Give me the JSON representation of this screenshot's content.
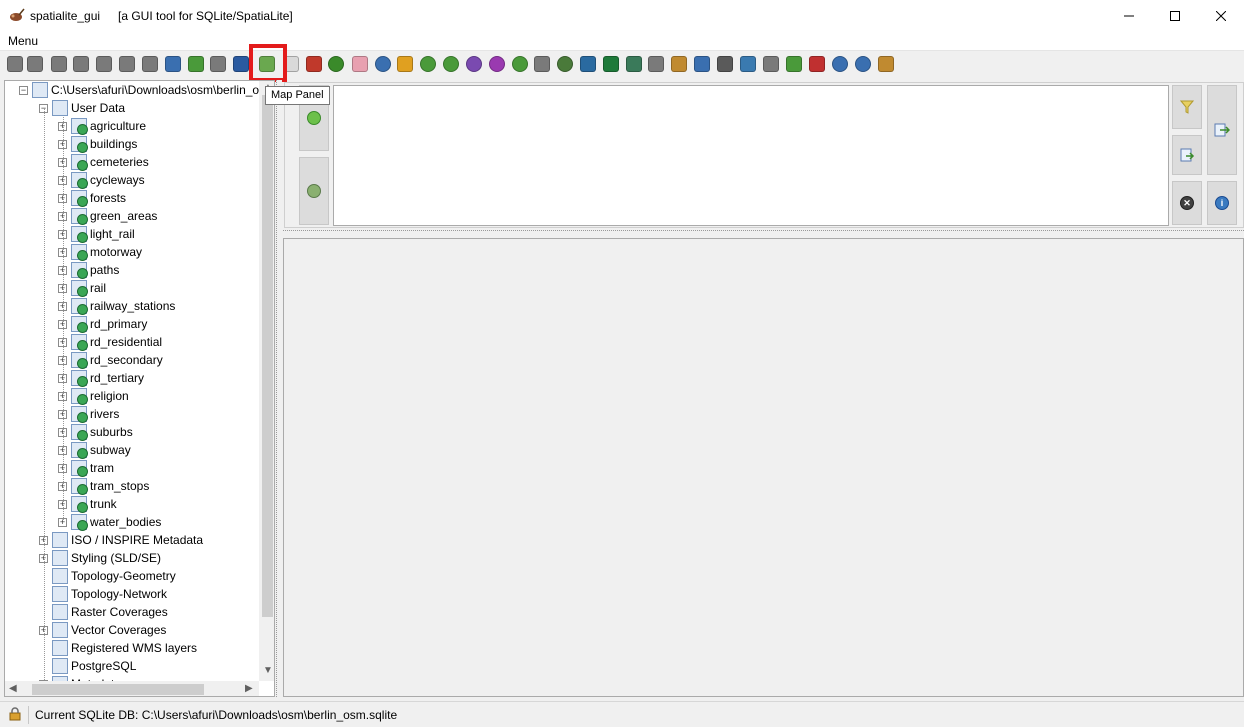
{
  "window": {
    "app_name": "spatialite_gui",
    "subtitle": "[a GUI tool for SQLite/SpatiaLite]",
    "controls": [
      "minimize",
      "maximize",
      "close"
    ]
  },
  "menubar": {
    "menu_label": "Menu"
  },
  "toolbar": {
    "tooltip": "Map Panel",
    "highlighted_button": "Map Panel",
    "icons": [
      {
        "name": "connect-icon",
        "color": "#7a7a7a"
      },
      {
        "name": "connect-mem-icon",
        "color": "#7a7a7a"
      },
      {
        "name": "disconnect-icon",
        "color": "#7a7a7a"
      },
      {
        "name": "new-db-icon",
        "color": "#7a7a7a"
      },
      {
        "name": "new-mem-db-icon",
        "color": "#7a7a7a"
      },
      {
        "name": "memory-db-load-icon",
        "color": "#7a7a7a"
      },
      {
        "name": "memory-db-save-icon",
        "color": "#7a7a7a"
      },
      {
        "name": "vacuum-icon",
        "color": "#3a6fb0"
      },
      {
        "name": "sql-script-icon",
        "color": "#4a9a3a"
      },
      {
        "name": "sql-log-icon",
        "color": "#7a7a7a"
      },
      {
        "name": "shapefile-icon",
        "color": "#2a5aa0"
      },
      {
        "name": "map-panel-icon",
        "color": "#6aa84f"
      },
      {
        "name": "query-composer-icon",
        "color": "#d9d9d9"
      },
      {
        "name": "charts-icon",
        "color": "#c0392b"
      },
      {
        "name": "check-geometries-icon",
        "color": "#3a8a2a"
      },
      {
        "name": "sanitize-icon",
        "color": "#e8a0b0"
      },
      {
        "name": "load-txt-icon",
        "color": "#3a6fb0"
      },
      {
        "name": "virtual-txt-icon",
        "color": "#e0a020"
      },
      {
        "name": "load-dbf-icon",
        "color": "#4a9a3a"
      },
      {
        "name": "virtual-dbf-icon",
        "color": "#4a9a3a"
      },
      {
        "name": "load-xl-icon",
        "color": "#7a4ab0"
      },
      {
        "name": "virtual-xl-icon",
        "color": "#9a3ab0"
      },
      {
        "name": "network-icon",
        "color": "#4a9a3a"
      },
      {
        "name": "exif-icon",
        "color": "#7a7a7a"
      },
      {
        "name": "gps-pics-icon",
        "color": "#4a7a3a"
      },
      {
        "name": "load-xml-icon",
        "color": "#2a6aa0"
      },
      {
        "name": "excel-icon",
        "color": "#1e7a3a"
      },
      {
        "name": "wfs-icon",
        "color": "#3a7a5a"
      },
      {
        "name": "dxf-icon",
        "color": "#7a7a7a"
      },
      {
        "name": "sql-history-icon",
        "color": "#c08a30"
      },
      {
        "name": "srids-icon",
        "color": "#3a6fb0"
      },
      {
        "name": "attach-icon",
        "color": "#5a5a5a"
      },
      {
        "name": "wms-icon",
        "color": "#3a7ab0"
      },
      {
        "name": "raster-icon",
        "color": "#7a7a7a"
      },
      {
        "name": "topology-icon",
        "color": "#4a9a3a"
      },
      {
        "name": "pdf-icon",
        "color": "#c03030"
      },
      {
        "name": "help-icon",
        "color": "#3a6fb0"
      },
      {
        "name": "about-icon",
        "color": "#3a6fb0"
      },
      {
        "name": "exit-icon",
        "color": "#c08a30"
      }
    ]
  },
  "tree": {
    "root_label": "C:\\Users\\afuri\\Downloads\\osm\\berlin_o",
    "user_data_label": "User Data",
    "tables": [
      "agriculture",
      "buildings",
      "cemeteries",
      "cycleways",
      "forests",
      "green_areas",
      "light_rail",
      "motorway",
      "paths",
      "rail",
      "railway_stations",
      "rd_primary",
      "rd_residential",
      "rd_secondary",
      "rd_tertiary",
      "religion",
      "rivers",
      "suburbs",
      "subway",
      "tram",
      "tram_stops",
      "trunk",
      "water_bodies"
    ],
    "groups": [
      {
        "label": "ISO / INSPIRE Metadata",
        "expandable": true
      },
      {
        "label": "Styling (SLD/SE)",
        "expandable": true
      },
      {
        "label": "Topology-Geometry",
        "expandable": false
      },
      {
        "label": "Topology-Network",
        "expandable": false
      },
      {
        "label": "Raster Coverages",
        "expandable": false
      },
      {
        "label": "Vector Coverages",
        "expandable": true
      },
      {
        "label": "Registered WMS layers",
        "expandable": false
      },
      {
        "label": "PostgreSQL",
        "expandable": false
      },
      {
        "label": "Metadata",
        "expandable": true
      }
    ]
  },
  "sql_panel": {
    "query_text": "",
    "left_buttons": [
      "history-next",
      "history-prev"
    ],
    "right_buttons": [
      "filter",
      "execute-sql",
      "load-sql",
      "clear",
      "info"
    ]
  },
  "status": {
    "text": "Current SQLite DB: C:\\Users\\afuri\\Downloads\\osm\\berlin_osm.sqlite"
  },
  "colors": {
    "highlight_box": "#e31b1b",
    "table_icon_badge": "#3aa655",
    "panel_bg": "#f0f0f0"
  }
}
